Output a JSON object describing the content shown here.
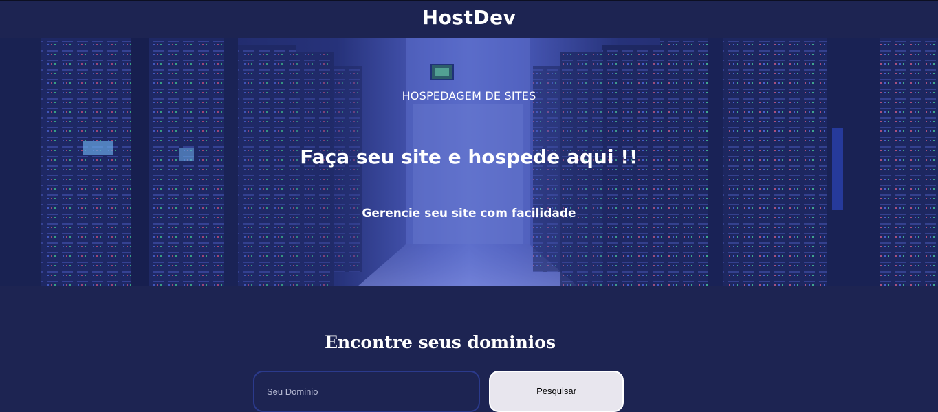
{
  "header": {
    "logo_text": "HostDev"
  },
  "hero": {
    "kicker": "HOSPEDAGEM DE SITES",
    "title": "Faça seu site e hospede aqui !!",
    "subtitle": "Gerencie seu site com facilidade",
    "image_icon": "server-room-image"
  },
  "domain_search": {
    "title": "Encontre seus dominios",
    "input_placeholder": "Seu Dominio",
    "input_value": "",
    "button_label": "Pesquisar"
  },
  "colors": {
    "page_background": "#1d2452",
    "hero_overlay": "#3b4ca8",
    "button_background": "#e8e6ee",
    "input_border": "#2b3a8c",
    "text": "#ffffff"
  }
}
